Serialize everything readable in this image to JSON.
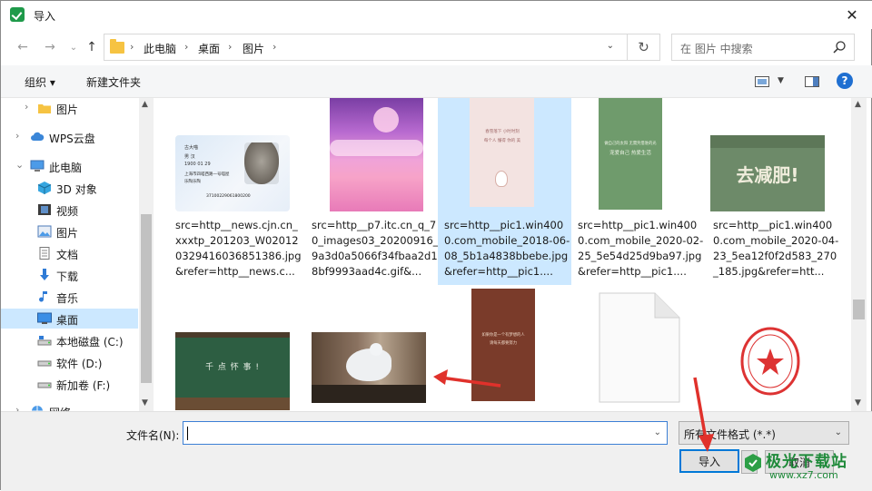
{
  "window": {
    "title": "导入",
    "close_glyph": "✕"
  },
  "address_bar": {
    "breadcrumbs": [
      "此电脑",
      "桌面",
      "图片"
    ],
    "separator": "›",
    "search_placeholder": "在 图片 中搜索"
  },
  "toolbar": {
    "organize_label": "组织 ▾",
    "new_folder_label": "新建文件夹",
    "help_glyph": "?"
  },
  "sidebar": {
    "items": [
      {
        "label": "图片",
        "icon": "folder-icon",
        "indent": 2,
        "selected": false
      },
      {
        "label": "WPS云盘",
        "icon": "cloud-icon",
        "indent": 1,
        "selected": false
      },
      {
        "label": "此电脑",
        "icon": "computer-icon",
        "indent": 1,
        "selected": false
      },
      {
        "label": "3D 对象",
        "icon": "cube-3d-icon",
        "indent": 2,
        "selected": false
      },
      {
        "label": "视频",
        "icon": "video-icon",
        "indent": 2,
        "selected": false
      },
      {
        "label": "图片",
        "icon": "picture-icon",
        "indent": 2,
        "selected": false
      },
      {
        "label": "文档",
        "icon": "document-icon",
        "indent": 2,
        "selected": false
      },
      {
        "label": "下载",
        "icon": "download-arrow-icon",
        "indent": 2,
        "selected": false
      },
      {
        "label": "音乐",
        "icon": "music-note-icon",
        "indent": 2,
        "selected": false
      },
      {
        "label": "桌面",
        "icon": "desktop-icon",
        "indent": 2,
        "selected": true
      },
      {
        "label": "本地磁盘 (C:)",
        "icon": "drive-c-icon",
        "indent": 2,
        "selected": false
      },
      {
        "label": "软件 (D:)",
        "icon": "drive-icon",
        "indent": 2,
        "selected": false
      },
      {
        "label": "新加卷 (F:)",
        "icon": "drive-icon",
        "indent": 2,
        "selected": false
      },
      {
        "label": "网络",
        "icon": "network-icon",
        "indent": 1,
        "selected": false
      }
    ]
  },
  "files": [
    {
      "caption": "src=http__news.cjn.cn_xxxtp_201203_W020120329416036851386.jpg&refer=http__news.c...",
      "thumb": "id-card",
      "selected": false,
      "thumb_text": {
        "name": "古大喵",
        "sex": "男 汉",
        "born": "1900 01 29",
        "addr1": "上海市四喵西路一号喵屋",
        "addr2": "乐陶乐陶",
        "id": "37100229061800200"
      }
    },
    {
      "caption": "src=http__p7.itc.cn_q_70_images03_20200916_9a3d0a5066f34fbaa2d18bf9993aad4c.gif&...",
      "thumb": "pink-clouds",
      "selected": false
    },
    {
      "caption": "src=http__pic1.win4000.com_mobile_2018-06-08_5b1a4838bbebe.jpg&refer=http__pic1....",
      "thumb": "pink-rabbit",
      "selected": true,
      "thumb_text": {
        "line1": "春雪落下 小时时刻",
        "line2": "每个人 懂得 你的 美"
      }
    },
    {
      "caption": "src=http__pic1.win4000.com_mobile_2020-02-25_5e54d25d9ba97.jpg&refer=http__pic1....",
      "thumb": "green-card",
      "selected": false,
      "thumb_text": {
        "line1": "做自己的太阳 无需凭借谁的光",
        "line2": "宠爱自己 热爱生活"
      }
    },
    {
      "caption": "src=http__pic1.win4000.com_mobile_2020-04-23_5ea12f0f2d583_270_185.jpg&refer=htt...",
      "thumb": "lose-weight",
      "selected": false,
      "thumb_text": {
        "line1": "去减肥!"
      }
    },
    {
      "caption": "",
      "thumb": "chalkboard",
      "selected": false,
      "thumb_text": {
        "line1": "千 点 怀 事 !"
      }
    },
    {
      "caption": "",
      "thumb": "dove",
      "selected": false
    },
    {
      "caption": "",
      "thumb": "brown-card",
      "selected": false,
      "thumb_text": {
        "line1": "如果你是一个有梦想的人",
        "line2": "请每天都要努力"
      }
    },
    {
      "caption": "",
      "thumb": "blank-file",
      "selected": false
    },
    {
      "caption": "",
      "thumb": "red-seal",
      "selected": false
    }
  ],
  "bottom": {
    "filename_label": "文件名(N):",
    "filename_value": "",
    "filter_value": "所有文件格式 (*.*)",
    "import_label": "导入",
    "cancel_label": "取消"
  },
  "watermark": {
    "line1": "极光下载站",
    "line2": "www.xz7.com"
  },
  "colors": {
    "selection": "#cce8ff",
    "accent": "#0078d7",
    "annotation_arrow": "#e0312b"
  }
}
